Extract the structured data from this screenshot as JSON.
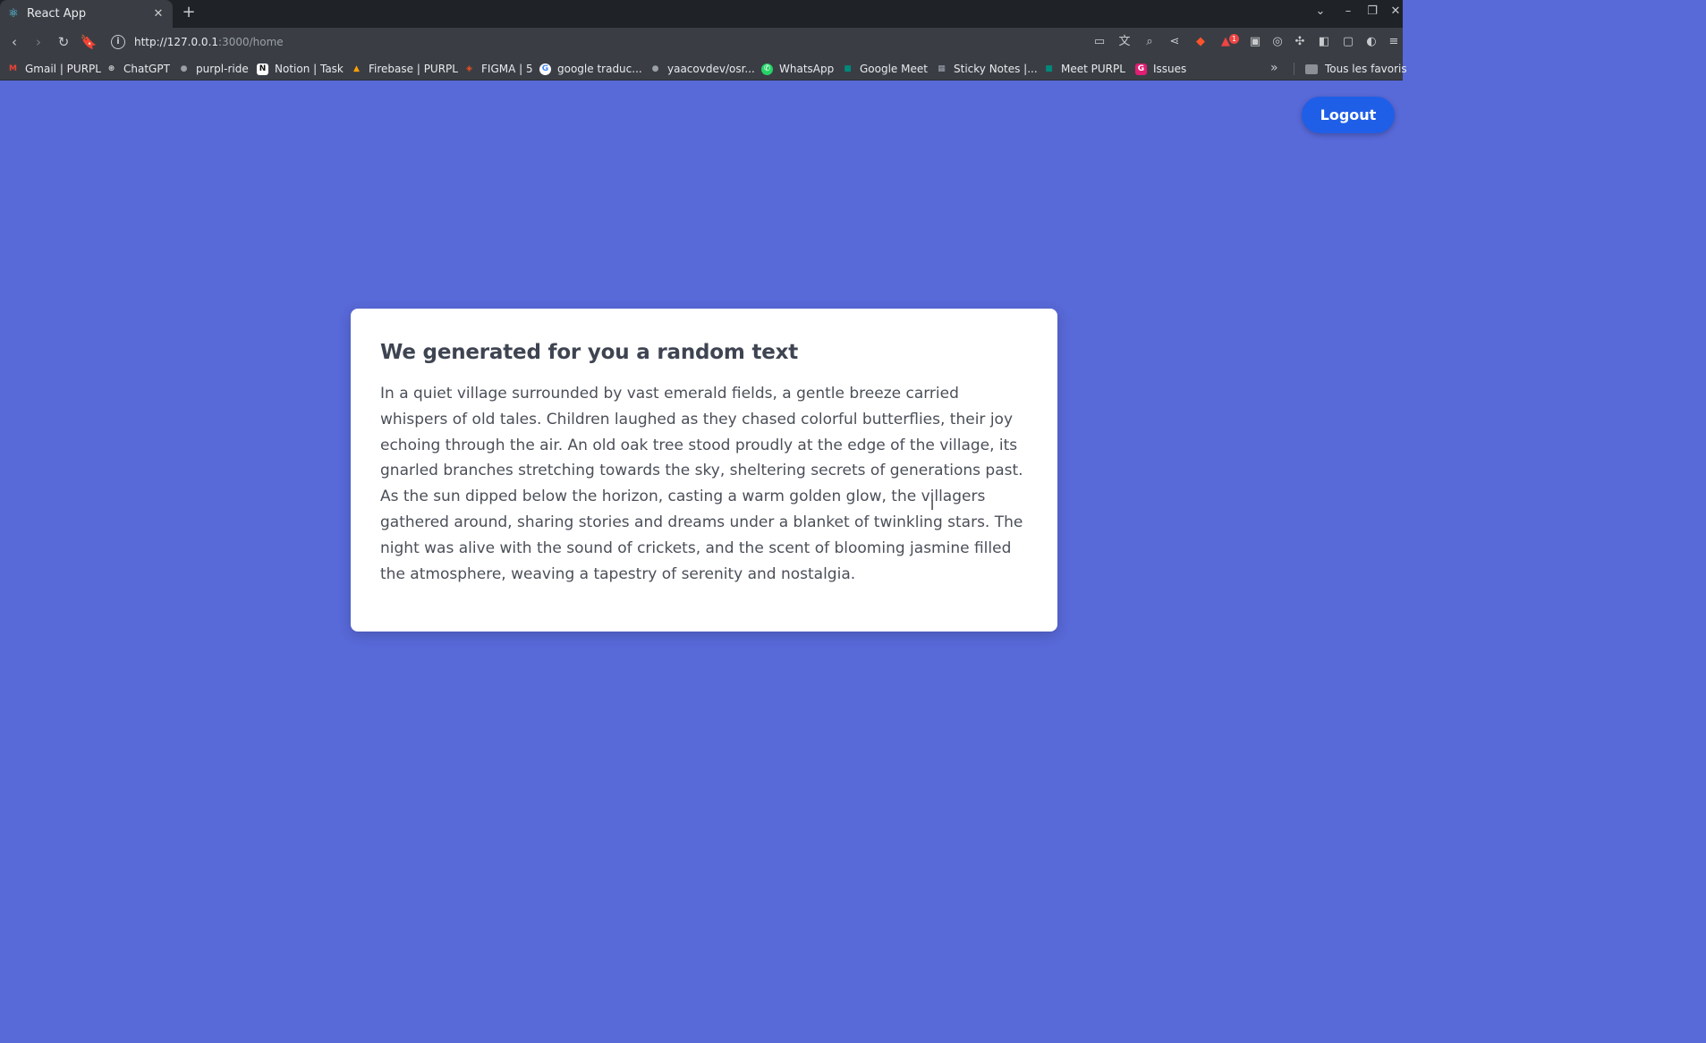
{
  "browser": {
    "tab": {
      "title": "React App",
      "icon": "react-icon"
    },
    "url": {
      "host": "http://127.0.0.1",
      "path": ":3000/home"
    },
    "extensions": {
      "badge_count": "1"
    },
    "bookmarks": [
      {
        "label": "Gmail | PURPL",
        "icon": "gmail-icon",
        "color": "#ea4335"
      },
      {
        "label": "ChatGPT",
        "icon": "chatgpt-icon",
        "color": "#d7d7d7"
      },
      {
        "label": "purpl-ride",
        "icon": "github-icon",
        "color": "#9aa0a6"
      },
      {
        "label": "Notion | Task",
        "icon": "notion-icon",
        "color": "#ffffff"
      },
      {
        "label": "Firebase | PURPL",
        "icon": "firebase-icon",
        "color": "#ffa000"
      },
      {
        "label": "FIGMA | 5",
        "icon": "figma-icon",
        "color": "#f24e1e"
      },
      {
        "label": "google traduc...",
        "icon": "google-icon",
        "color": "#4285f4"
      },
      {
        "label": "yaacovdev/osr...",
        "icon": "github-icon",
        "color": "#9aa0a6"
      },
      {
        "label": "WhatsApp",
        "icon": "whatsapp-icon",
        "color": "#25d366"
      },
      {
        "label": "Google Meet",
        "icon": "google-meet-icon",
        "color": "#00897b"
      },
      {
        "label": "Sticky Notes |...",
        "icon": "sticky-notes-icon",
        "color": "#6b7280"
      },
      {
        "label": "Meet PURPL",
        "icon": "google-meet-icon",
        "color": "#00897b"
      },
      {
        "label": "Issues",
        "icon": "issues-icon",
        "color": "#e11d74"
      }
    ],
    "all_bookmarks_label": "Tous les favoris"
  },
  "page": {
    "logout_label": "Logout",
    "card_title": "We generated for you a random text",
    "card_text": "In a quiet village surrounded by vast emerald fields, a gentle breeze carried whispers of old tales. Children laughed as they chased colorful butterflies, their joy echoing through the air. An old oak tree stood proudly at the edge of the village, its gnarled branches stretching towards the sky, sheltering secrets of generations past. As the sun dipped below the horizon, casting a warm golden glow, the villagers gathered around, sharing stories and dreams under a blanket of twinkling stars. The night was alive with the sound of crickets, and the scent of blooming jasmine filled the atmosphere, weaving a tapestry of serenity and nostalgia."
  },
  "colors": {
    "page_background": "#5869d8",
    "logout_button": "#1f5fe8",
    "card_background": "#ffffff",
    "title_text": "#3e4451",
    "body_text": "#4b4f58"
  }
}
